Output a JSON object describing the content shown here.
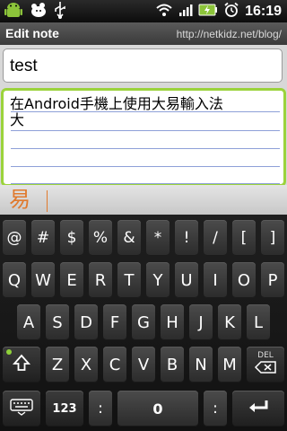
{
  "status_bar": {
    "time": "16:19",
    "left_icons": [
      "android-icon",
      "pet-icon",
      "usb-icon"
    ],
    "right_icons": [
      "wifi-icon",
      "signal-icon",
      "battery-icon",
      "alarm-icon"
    ]
  },
  "header": {
    "title": "Edit note",
    "url": "http://netkidz.net/blog/"
  },
  "note": {
    "title_value": "test",
    "body_lines": [
      "在Android手機上使用大易輸入法",
      "大"
    ]
  },
  "ime": {
    "composing": "易"
  },
  "keyboard": {
    "row1": [
      "@",
      "#",
      "$",
      "%",
      "&",
      "*",
      "!",
      "/",
      "[",
      "]"
    ],
    "row2": [
      "Q",
      "W",
      "E",
      "R",
      "T",
      "Y",
      "U",
      "I",
      "O",
      "P"
    ],
    "row3": [
      "A",
      "S",
      "D",
      "F",
      "G",
      "H",
      "J",
      "K",
      "L"
    ],
    "row4": [
      "Z",
      "X",
      "C",
      "V",
      "B",
      "N",
      "M"
    ],
    "delete_label": "DEL",
    "numbers_label": "123",
    "colon_left": ":",
    "colon_right": ":",
    "space_label": "0"
  },
  "colors": {
    "accent_green": "#9bd33b",
    "composing_orange": "#e07a2e"
  }
}
